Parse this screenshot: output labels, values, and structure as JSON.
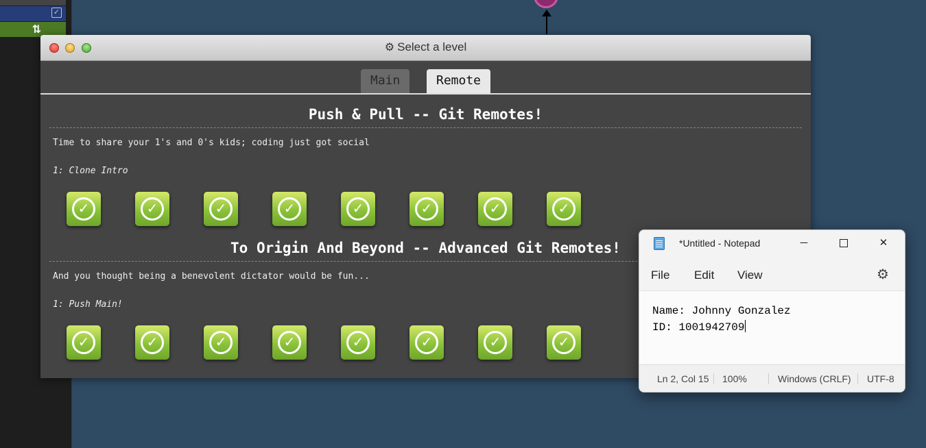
{
  "level_window": {
    "title": "Select a level",
    "tabs": [
      {
        "label": "Main",
        "active": false
      },
      {
        "label": "Remote",
        "active": true
      }
    ],
    "sections": [
      {
        "heading": "Push & Pull -- Git Remotes!",
        "description": "Time to share your 1's and 0's kids; coding just got social",
        "level_name": "1: Clone Intro",
        "levels_completed": 8
      },
      {
        "heading": "To Origin And Beyond -- Advanced Git Remotes!",
        "description": "And you thought being a benevolent dictator would be fun...",
        "level_name": "1: Push Main!",
        "levels_completed": 8
      }
    ]
  },
  "notepad": {
    "title": "*Untitled - Notepad",
    "menu": {
      "file": "File",
      "edit": "Edit",
      "view": "View"
    },
    "content": {
      "line1": "Name: Johnny Gonzalez",
      "line2": "ID: 1001942709"
    },
    "status": {
      "position": "Ln 2, Col 15",
      "zoom": "100%",
      "line_ending": "Windows (CRLF)",
      "encoding": "UTF-8"
    }
  },
  "colors": {
    "background": "#2f4a63",
    "level_complete": "#8bc23a",
    "commit_node": "#8c2a6b"
  }
}
